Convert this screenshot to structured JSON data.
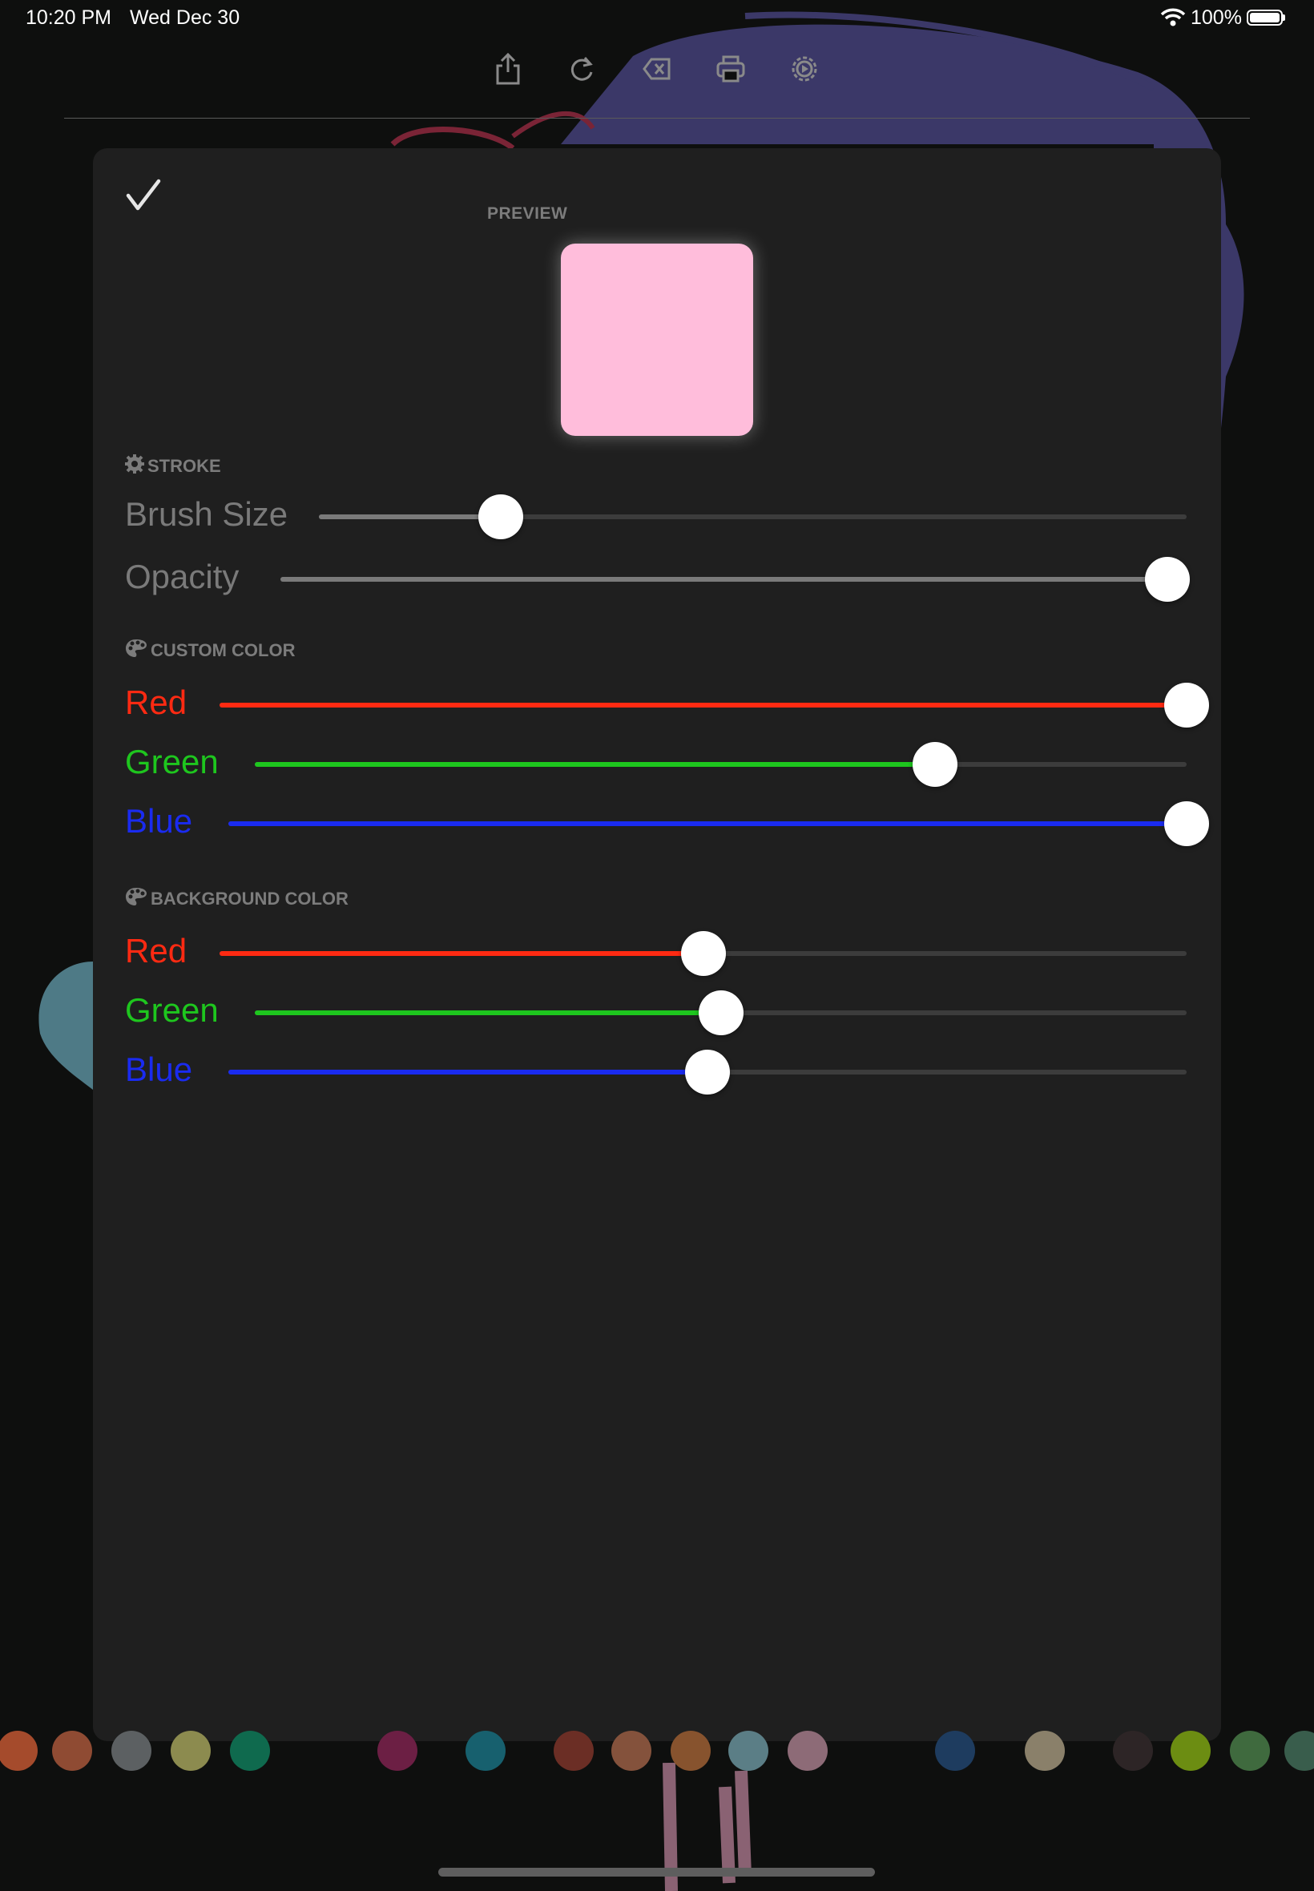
{
  "status_bar": {
    "time": "10:20 PM",
    "date": "Wed Dec 30",
    "battery": "100%"
  },
  "toolbar": {
    "icons": [
      "share-icon",
      "redo-icon",
      "clear-icon",
      "print-icon",
      "settings-icon"
    ]
  },
  "panel": {
    "confirm_icon": "checkmark-icon",
    "preview_label": "PREVIEW",
    "preview_color": "#ffbddb",
    "stroke": {
      "heading": "STROKE",
      "icon": "gear-icon",
      "brush_size": {
        "label": "Brush Size",
        "value": 0.21
      },
      "opacity": {
        "label": "Opacity",
        "value": 1.0
      }
    },
    "custom_color": {
      "heading": "CUSTOM COLOR",
      "icon": "palette-icon",
      "red": {
        "label": "Red",
        "value": 1.0,
        "color": "#ff2a12"
      },
      "green": {
        "label": "Green",
        "value": 0.73,
        "color": "#1ec61e"
      },
      "blue": {
        "label": "Blue",
        "value": 1.0,
        "color": "#1a2bf0"
      }
    },
    "background_color": {
      "heading": "BACKGROUND COLOR",
      "icon": "palette-icon",
      "red": {
        "label": "Red",
        "value": 0.5,
        "color": "#ff2a12"
      },
      "green": {
        "label": "Green",
        "value": 0.5,
        "color": "#1ec61e"
      },
      "blue": {
        "label": "Blue",
        "value": 0.5,
        "color": "#1a2bf0"
      }
    }
  },
  "palette_dots": [
    "#a54b2c",
    "#8f4b33",
    "#5c6062",
    "#8c8b4f",
    "#0f6a4e",
    "#6c1f44",
    "#17606e",
    "#6b2e25",
    "#84523c",
    "#87532e",
    "#5b7e86",
    "#8d6b77",
    "#1e3c5f",
    "#8a806a",
    "#2d2526",
    "#6c8d12",
    "#3f6a3e",
    "#395d4c"
  ]
}
